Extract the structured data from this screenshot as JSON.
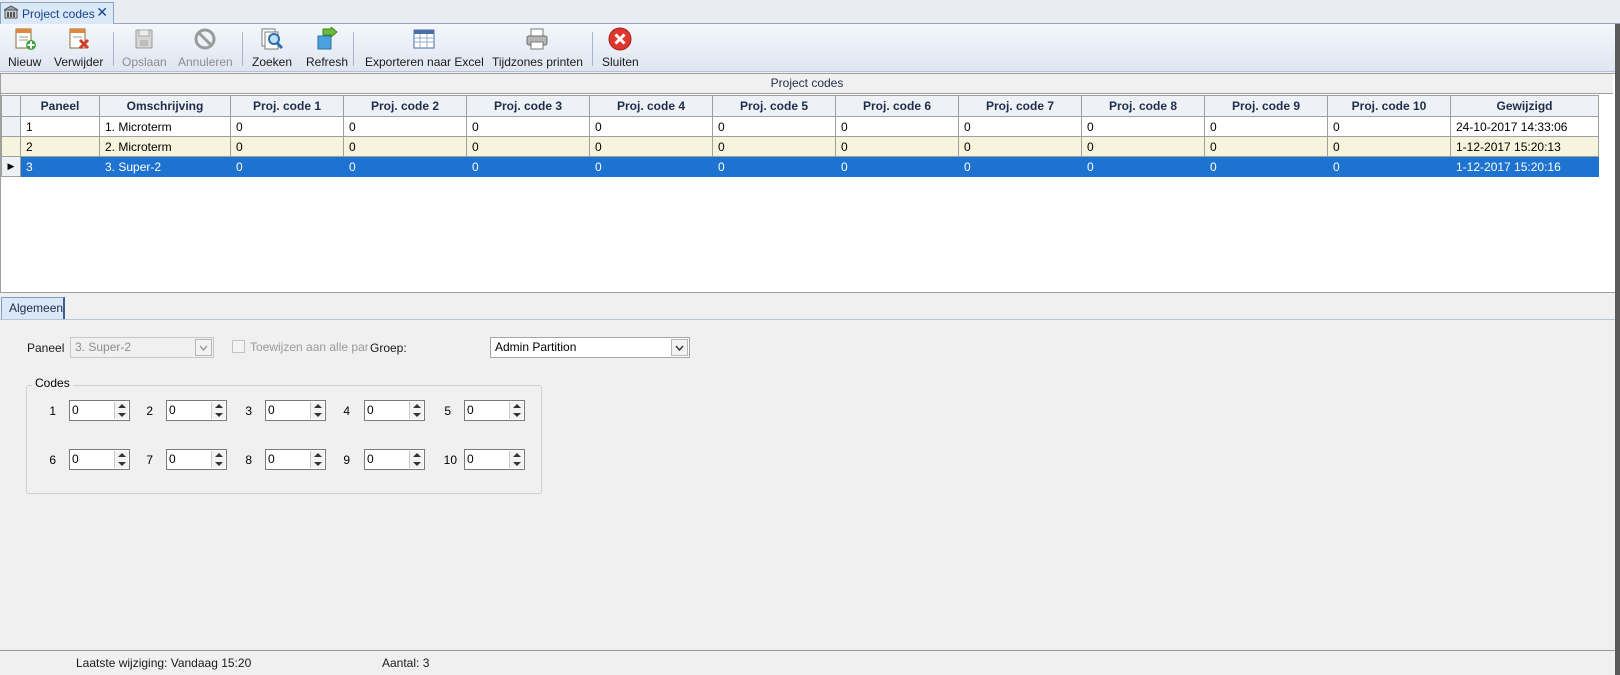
{
  "document_tab": {
    "label": "Project codes",
    "close": "✕"
  },
  "toolbar": {
    "buttons": [
      {
        "label": "Nieuw",
        "icon": "new-doc-icon",
        "enabled": true
      },
      {
        "label": "Verwijder",
        "icon": "delete-doc-icon",
        "enabled": true
      },
      {
        "label": "Opslaan",
        "icon": "save-icon",
        "enabled": false
      },
      {
        "label": "Annuleren",
        "icon": "cancel-icon",
        "enabled": false
      },
      {
        "label": "Zoeken",
        "icon": "search-icon",
        "enabled": true
      },
      {
        "label": "Refresh",
        "icon": "refresh-icon",
        "enabled": true
      },
      {
        "label": "Exporteren naar Excel",
        "icon": "excel-export-icon",
        "enabled": true
      },
      {
        "label": "Tijdzones printen",
        "icon": "printer-icon",
        "enabled": true
      },
      {
        "label": "Sluiten",
        "icon": "close-red-icon",
        "enabled": true
      }
    ]
  },
  "grid": {
    "caption": "Project codes",
    "columns": [
      "Paneel",
      "Omschrijving",
      "Proj. code 1",
      "Proj. code 2",
      "Proj. code 3",
      "Proj. code 4",
      "Proj. code 5",
      "Proj. code 6",
      "Proj. code 7",
      "Proj. code 8",
      "Proj. code 9",
      "Proj. code 10",
      "Gewijzigd"
    ],
    "rows": [
      [
        "1",
        "1. Microterm",
        "0",
        "0",
        "0",
        "0",
        "0",
        "0",
        "0",
        "0",
        "0",
        "0",
        "24-10-2017 14:33:06"
      ],
      [
        "2",
        "2. Microterm",
        "0",
        "0",
        "0",
        "0",
        "0",
        "0",
        "0",
        "0",
        "0",
        "0",
        "1-12-2017 15:20:13"
      ],
      [
        "3",
        "3. Super-2",
        "0",
        "0",
        "0",
        "0",
        "0",
        "0",
        "0",
        "0",
        "0",
        "0",
        "1-12-2017 15:20:16"
      ]
    ],
    "selected_row": 2
  },
  "detail": {
    "tab_label": "Algemeen",
    "paneel_label": "Paneel",
    "paneel_value": "3. Super-2",
    "assign_all_label": "Toewijzen aan alle panelen",
    "groep_label": "Groep:",
    "groep_value": "Admin Partition",
    "codes_legend": "Codes",
    "codes": [
      {
        "label": "1",
        "value": "0"
      },
      {
        "label": "2",
        "value": "0"
      },
      {
        "label": "3",
        "value": "0"
      },
      {
        "label": "4",
        "value": "0"
      },
      {
        "label": "5",
        "value": "0"
      },
      {
        "label": "6",
        "value": "0"
      },
      {
        "label": "7",
        "value": "0"
      },
      {
        "label": "8",
        "value": "0"
      },
      {
        "label": "9",
        "value": "0"
      },
      {
        "label": "10",
        "value": "0"
      }
    ]
  },
  "status": {
    "last_change": "Laatste wijziging: Vandaag 15:20",
    "count": "Aantal: 3"
  },
  "colors": {
    "selection": "#1e73d1",
    "alt_row": "#f6f4dc",
    "accent": "#15428b"
  }
}
